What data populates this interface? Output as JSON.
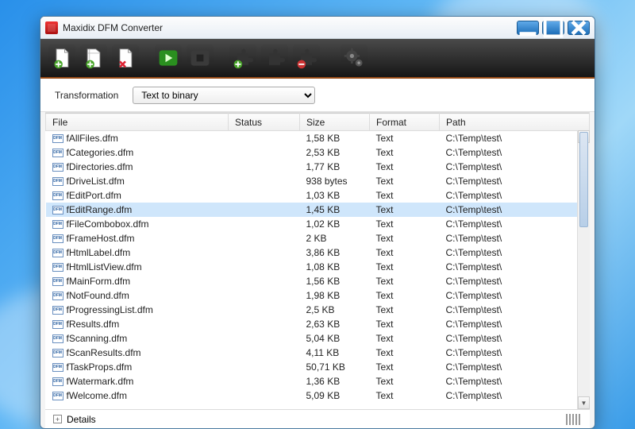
{
  "window": {
    "title": "Maxidix DFM Converter"
  },
  "transformation": {
    "label": "Transformation",
    "selected": "Text to binary"
  },
  "columns": {
    "file": "File",
    "status": "Status",
    "size": "Size",
    "format": "Format",
    "path": "Path"
  },
  "footer": {
    "details": "Details"
  },
  "selected_index": 5,
  "files": [
    {
      "name": "fAllFiles.dfm",
      "status": "",
      "size": "1,58 KB",
      "format": "Text",
      "path": "C:\\Temp\\test\\"
    },
    {
      "name": "fCategories.dfm",
      "status": "",
      "size": "2,53 KB",
      "format": "Text",
      "path": "C:\\Temp\\test\\"
    },
    {
      "name": "fDirectories.dfm",
      "status": "",
      "size": "1,77 KB",
      "format": "Text",
      "path": "C:\\Temp\\test\\"
    },
    {
      "name": "fDriveList.dfm",
      "status": "",
      "size": "938 bytes",
      "format": "Text",
      "path": "C:\\Temp\\test\\"
    },
    {
      "name": "fEditPort.dfm",
      "status": "",
      "size": "1,03 KB",
      "format": "Text",
      "path": "C:\\Temp\\test\\"
    },
    {
      "name": "fEditRange.dfm",
      "status": "",
      "size": "1,45 KB",
      "format": "Text",
      "path": "C:\\Temp\\test\\"
    },
    {
      "name": "fFileCombobox.dfm",
      "status": "",
      "size": "1,02 KB",
      "format": "Text",
      "path": "C:\\Temp\\test\\"
    },
    {
      "name": "fFrameHost.dfm",
      "status": "",
      "size": "2 KB",
      "format": "Text",
      "path": "C:\\Temp\\test\\"
    },
    {
      "name": "fHtmlLabel.dfm",
      "status": "",
      "size": "3,86 KB",
      "format": "Text",
      "path": "C:\\Temp\\test\\"
    },
    {
      "name": "fHtmlListView.dfm",
      "status": "",
      "size": "1,08 KB",
      "format": "Text",
      "path": "C:\\Temp\\test\\"
    },
    {
      "name": "fMainForm.dfm",
      "status": "",
      "size": "1,56 KB",
      "format": "Text",
      "path": "C:\\Temp\\test\\"
    },
    {
      "name": "fNotFound.dfm",
      "status": "",
      "size": "1,98 KB",
      "format": "Text",
      "path": "C:\\Temp\\test\\"
    },
    {
      "name": "fProgressingList.dfm",
      "status": "",
      "size": "2,5 KB",
      "format": "Text",
      "path": "C:\\Temp\\test\\"
    },
    {
      "name": "fResults.dfm",
      "status": "",
      "size": "2,63 KB",
      "format": "Text",
      "path": "C:\\Temp\\test\\"
    },
    {
      "name": "fScanning.dfm",
      "status": "",
      "size": "5,04 KB",
      "format": "Text",
      "path": "C:\\Temp\\test\\"
    },
    {
      "name": "fScanResults.dfm",
      "status": "",
      "size": "4,11 KB",
      "format": "Text",
      "path": "C:\\Temp\\test\\"
    },
    {
      "name": "fTaskProps.dfm",
      "status": "",
      "size": "50,71 KB",
      "format": "Text",
      "path": "C:\\Temp\\test\\"
    },
    {
      "name": "fWatermark.dfm",
      "status": "",
      "size": "1,36 KB",
      "format": "Text",
      "path": "C:\\Temp\\test\\"
    },
    {
      "name": "fWelcome.dfm",
      "status": "",
      "size": "5,09 KB",
      "format": "Text",
      "path": "C:\\Temp\\test\\"
    }
  ]
}
